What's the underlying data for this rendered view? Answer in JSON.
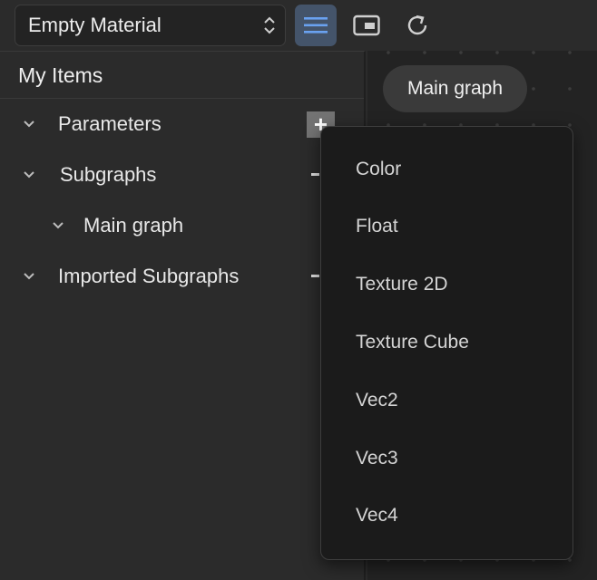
{
  "toolbar": {
    "material_name": "Empty Material",
    "buttons": [
      "list-view-icon",
      "frame-icon",
      "refresh-icon"
    ]
  },
  "left_panel": {
    "title": "My Items",
    "tree": [
      {
        "label": "Parameters"
      },
      {
        "label": "Subgraphs"
      },
      {
        "label": "Main graph"
      },
      {
        "label": "Imported Subgraphs"
      }
    ],
    "add_label": "+"
  },
  "canvas": {
    "tab_label": "Main graph"
  },
  "menu": {
    "items": [
      "Color",
      "Float",
      "Texture 2D",
      "Texture Cube",
      "Vec2",
      "Vec3",
      "Vec4"
    ]
  },
  "colors": {
    "accent": "#5b8fd6",
    "active_button": "#44546a"
  }
}
